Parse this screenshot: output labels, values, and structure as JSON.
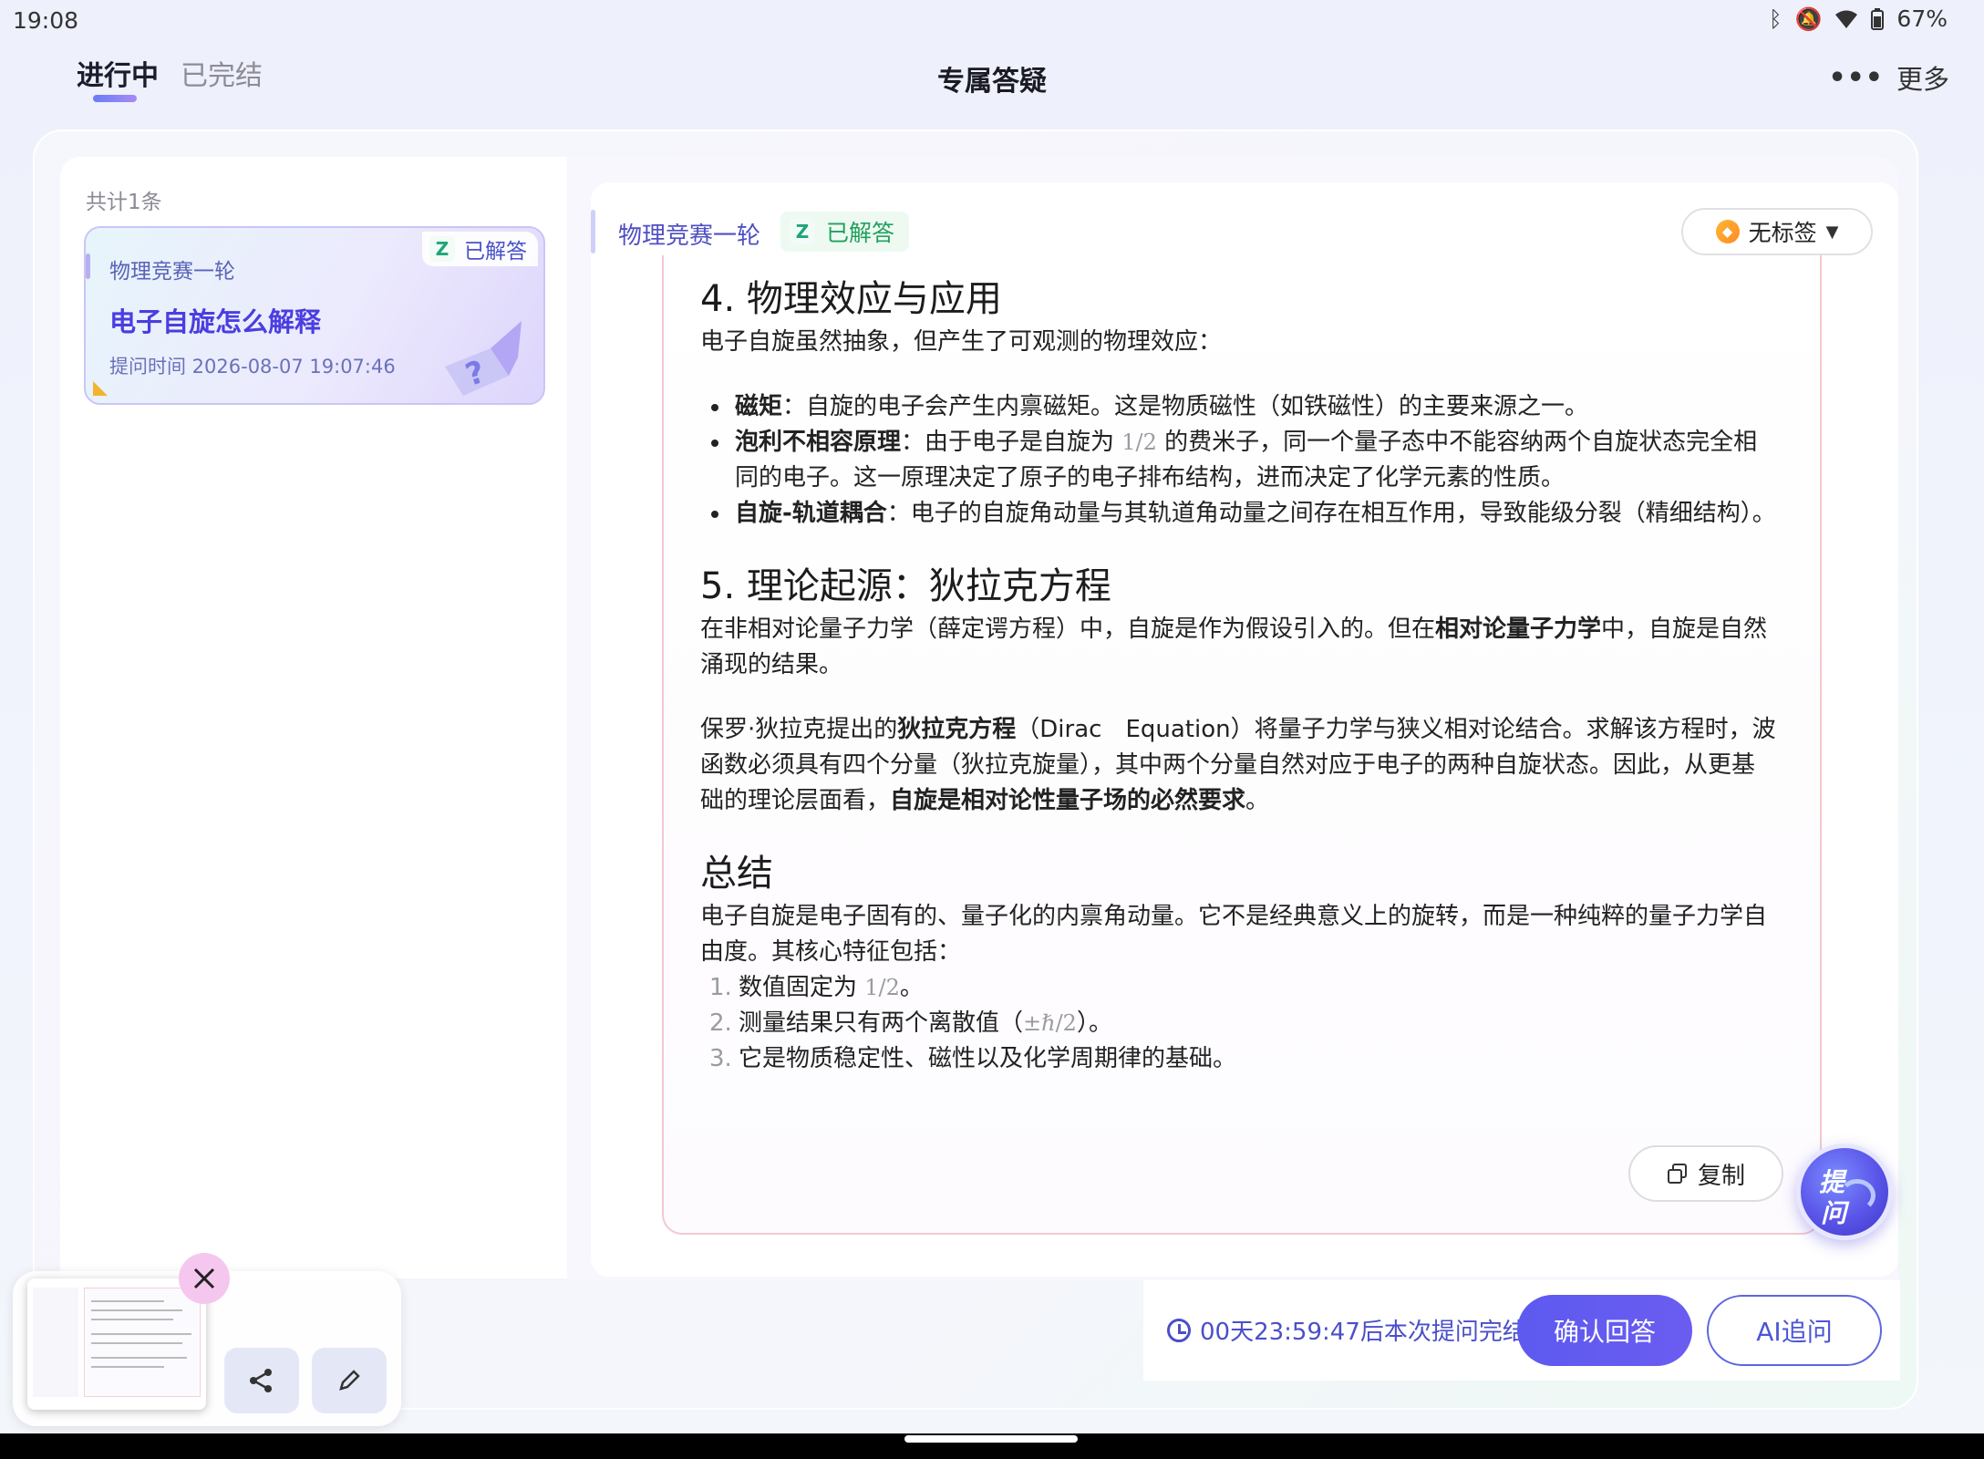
{
  "status": {
    "time": "19:08",
    "battery": "67%"
  },
  "header": {
    "tabs": [
      {
        "label": "进行中"
      },
      {
        "label": "已完结"
      }
    ],
    "title": "专属答疑",
    "more_label": "更多"
  },
  "list": {
    "count_label": "共计1条",
    "items": [
      {
        "subject": "物理竞赛一轮",
        "status": "已解答",
        "title": "电子自旋怎么解释",
        "ask_time": "提问时间 2026-08-07 19:07:46"
      }
    ]
  },
  "detail": {
    "subject": "物理竞赛一轮",
    "status": "已解答",
    "tag_label": "无标签",
    "copy_label": "复制",
    "ask_label_1": "提",
    "ask_label_2": "问"
  },
  "answer": {
    "s4_title": "4. 物理效应与应用",
    "s4_intro": "电子自旋虽然抽象，但产生了可观测的物理效应：",
    "b1_bold": "磁矩",
    "b1_text": "：自旋的电子会产生内禀磁矩。这是物质磁性（如铁磁性）的主要来源之一。",
    "b2_bold": "泡利不相容原理",
    "b2_text_a": "：由于电子是自旋为 ",
    "b2_math": "1/2",
    "b2_text_b": " 的费米子，同一个量子态中不能容纳两个自旋状态完全相同的电子。这一原理决定了原子的电子排布结构，进而决定了化学元素的性质。",
    "b3_bold": "自旋-轨道耦合",
    "b3_text": "：电子的自旋角动量与其轨道角动量之间存在相互作用，导致能级分裂（精细结构）。",
    "s5_title": "5. 理论起源：狄拉克方程",
    "s5_p1_a": "在非相对论量子力学（薛定谔方程）中，自旋是作为假设引入的。但在",
    "s5_p1_bold": "相对论量子力学",
    "s5_p1_b": "中，自旋是自然涌现的结果。",
    "s5_p2_a": "保罗·狄拉克提出的",
    "s5_p2_bold1": "狄拉克方程",
    "s5_p2_b": "（Dirac　Equation）将量子力学与狭义相对论结合。求解该方程时，波函数必须具有四个分量（狄拉克旋量），其中两个分量自然对应于电子的两种自旋状态。因此，从更基础的理论层面看，",
    "s5_p2_bold2": "自旋是相对论性量子场的必然要求",
    "s5_p2_c": "。",
    "sum_title": "总结",
    "sum_intro": "电子自旋是电子固有的、量子化的内禀角动量。它不是经典意义上的旋转，而是一种纯粹的量子力学自由度。其核心特征包括：",
    "o1_num": "1.",
    "o1_a": "数值固定为 ",
    "o1_math": "1/2",
    "o1_b": "。",
    "o2_num": "2.",
    "o2_a": "测量结果只有两个离散值（",
    "o2_math": "±ℏ/2",
    "o2_b": "）。",
    "o3_num": "3.",
    "o3_a": "它是物质稳定性、磁性以及化学周期律的基础。"
  },
  "footer": {
    "countdown": "00天23:59:47后本次提问完结",
    "confirm_label": "确认回答",
    "ai_label": "AI追问"
  }
}
